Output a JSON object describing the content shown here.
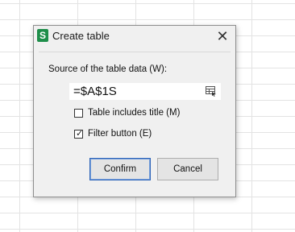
{
  "dialog": {
    "title": "Create table",
    "app_icon_letter": "S",
    "close_glyph": "✕",
    "source_label": "Source of the table data (W):",
    "source_value": "=$A$1S",
    "include_title_label": "Table includes title (M)",
    "include_title_checked": false,
    "filter_button_label": "Filter button (E)",
    "filter_button_checked": true,
    "check_glyph": "✓",
    "confirm_label": "Confirm",
    "cancel_label": "Cancel"
  },
  "colors": {
    "app_icon": "#1e8e4a",
    "dialog_bg": "#f0f0f0",
    "primary_border": "#2e64b8"
  },
  "icons": {
    "app": "spreadsheet-app-icon",
    "close": "close-icon",
    "range_picker": "range-select-icon"
  }
}
